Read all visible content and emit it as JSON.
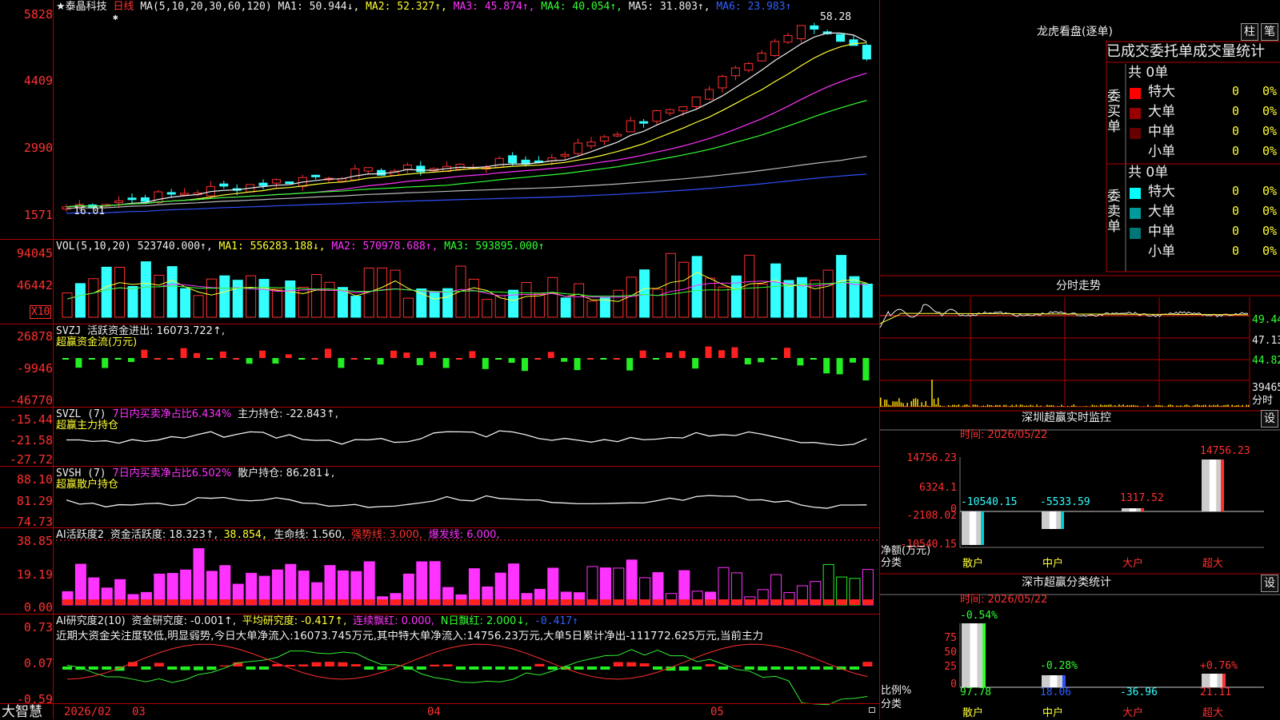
{
  "stock": {
    "name": "★泰晶科技",
    "star_mark": "✱",
    "period": "日线"
  },
  "price": {
    "ma_params": "MA(5,10,20,30,60,120)",
    "ma1": "MA1: 50.944↓,",
    "ma2": "MA2: 52.327↑,",
    "ma3": "MA3: 45.874↑,",
    "ma4": "MA4: 40.054↑,",
    "ma5": "MA5: 31.803↑,",
    "ma6": "MA6: 23.983↑",
    "axis": [
      "5828",
      "4409",
      "2990",
      "1571"
    ],
    "high_label": "58.28",
    "low_label": "16.01"
  },
  "vol": {
    "params": "VOL(5,10,20)",
    "value": "523740.000↑,",
    "ma1": "MA1: 556283.188↓,",
    "ma2": "MA2: 570978.688↑,",
    "ma3": "MA3: 593895.000↑",
    "axis": [
      "94045",
      "46442"
    ],
    "unit": "X10"
  },
  "svzj": {
    "name": "SVZJ",
    "text": "活跃资金进出: 16073.722↑,",
    "sub": "超赢资金流(万元)",
    "axis": [
      "26878",
      "-9946",
      "-46770"
    ]
  },
  "svzl": {
    "name": "SVZL (7)",
    "pct": "7日内买卖净占比6.434%",
    "hold": "主力持仓: -22.843↑,",
    "sub": "超赢主力持仓",
    "axis": [
      "-15.44",
      "-21.58",
      "-27.72"
    ]
  },
  "svsh": {
    "name": "SVSH (7)",
    "pct": "7日内买卖净占比6.502%",
    "hold": "散户持仓: 86.281↓,",
    "sub": "超赢散户持仓",
    "axis": [
      "88.10",
      "81.29",
      "74.73"
    ]
  },
  "ai1": {
    "name": "AI活跃度2",
    "t1": "资金活跃度: 18.323↑,",
    "t2": "38.854,",
    "t3": "生命线: 1.560,",
    "t4": "强势线: 3.000,",
    "t5": "爆发线: 6.000,",
    "axis": [
      "38.85",
      "19.19",
      "0.00"
    ]
  },
  "ai2": {
    "name": "AI研究度2(10)",
    "t1": "资金研究度: -0.001↑,",
    "t2": "平均研究度: -0.417↑,",
    "t3": "连续飘红: 0.000,",
    "t4": "N日飘红: 2.000↓,",
    "t5": "-0.417↑",
    "desc": "近期大资金关注度较低,明显弱势,今日大单净流入:16073.745万元,其中特大单净流入:14756.23万元,大单5日累计净出-111772.625万元,当前主力",
    "axis": [
      "0.73",
      "0.07",
      "-0.59"
    ]
  },
  "dates": [
    "2026/02",
    "03",
    "04",
    "05"
  ],
  "brand": "大智慧",
  "right": {
    "lhb_title": "龙虎看盘(逐单)",
    "btn_zhu": "柱",
    "btn_bi": "笔",
    "stats_title": "已成交委托单成交量统计",
    "buy_label": "委买单",
    "sell_label": "委卖单",
    "buy": {
      "total": "共 0单",
      "rows": [
        {
          "label": "特大",
          "v": "0",
          "p": "0%",
          "color": "#ff0000"
        },
        {
          "label": "大单",
          "v": "0",
          "p": "0%",
          "color": "#990000"
        },
        {
          "label": "中单",
          "v": "0",
          "p": "0%",
          "color": "#660000"
        },
        {
          "label": "小单",
          "v": "0",
          "p": "0%",
          "color": "#000"
        }
      ]
    },
    "sell": {
      "total": "共 0单",
      "rows": [
        {
          "label": "特大",
          "v": "0",
          "p": "0%",
          "color": "#00ffff"
        },
        {
          "label": "大单",
          "v": "0",
          "p": "0%",
          "color": "#009999"
        },
        {
          "label": "中单",
          "v": "0",
          "p": "0%",
          "color": "#007777"
        },
        {
          "label": "小单",
          "v": "0",
          "p": "0%",
          "color": "#000"
        }
      ]
    },
    "intraday_title": "分时走势",
    "intraday_axis": [
      "49.44",
      "47.13",
      "44.82",
      "39465"
    ],
    "intraday_unit": "分时",
    "sz_title": "深圳超赢实时监控",
    "btn_set": "设",
    "sz_time": "时间: 2026/05/22",
    "sz_axis": [
      "14756.23",
      "6324.1",
      "0",
      "-2108.02",
      "-10540.15"
    ],
    "sz_ylabel": "净额(万元)",
    "sz_xlabel": "分类",
    "sz_values": [
      {
        "cat": "散户",
        "val": "-10540.15"
      },
      {
        "cat": "中户",
        "val": "-5533.59"
      },
      {
        "cat": "大户",
        "val": "1317.52"
      },
      {
        "cat": "超大",
        "val": "14756.23"
      }
    ],
    "cls_title": "深市超赢分类统计",
    "cls_time": "时间: 2026/05/22",
    "cls_axis": [
      "75",
      "50",
      "25",
      "0"
    ],
    "cls_ylabel": "比例%",
    "cls_xlabel": "分类",
    "cls_top": [
      "-0.54%",
      "-0.28%",
      "",
      "+0.76%"
    ],
    "cls_bottom": [
      "97.78",
      "18.06",
      "-36.96",
      "21.11"
    ],
    "cls_cats": [
      "散户",
      "中户",
      "大户",
      "超大"
    ]
  }
}
